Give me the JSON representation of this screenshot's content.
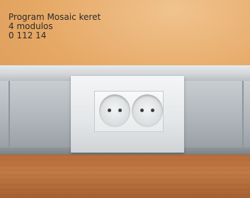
{
  "caption": {
    "line1": "Program Mosaic keret",
    "line2": "4 modulos",
    "line3": "0 112 14"
  }
}
